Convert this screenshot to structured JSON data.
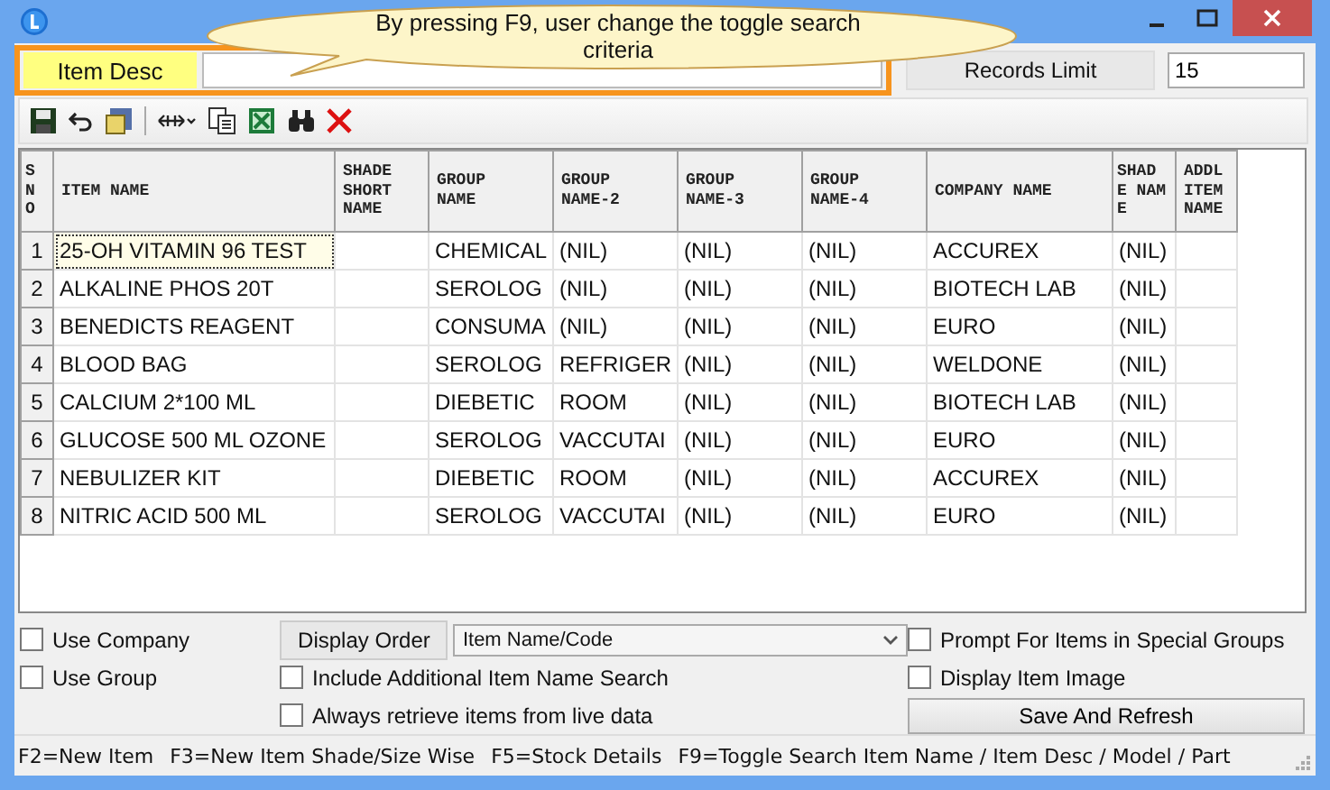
{
  "callout": {
    "text": "By pressing F9, user change the toggle search criteria"
  },
  "search": {
    "mode_label": "Item Desc",
    "records_limit_label": "Records Limit",
    "records_limit": "15"
  },
  "table": {
    "columns": [
      "S N O",
      "ITEM NAME",
      "SHADE SHORT NAME",
      "GROUP NAME",
      "GROUP NAME-2",
      "GROUP NAME-3",
      "GROUP NAME-4",
      "COMPANY NAME",
      "SHAD E NAME",
      "ADDL ITEM NAME"
    ],
    "rows": [
      {
        "selected": true,
        "cells": [
          "1",
          "25-OH VITAMIN 96 TEST",
          "",
          "CHEMICAL",
          "(NIL)",
          "(NIL)",
          "(NIL)",
          "ACCUREX",
          "(NIL)",
          ""
        ]
      },
      {
        "selected": false,
        "cells": [
          "2",
          "ALKALINE PHOS 20T",
          "",
          "SEROLOG",
          "(NIL)",
          "(NIL)",
          "(NIL)",
          "BIOTECH LAB",
          "(NIL)",
          ""
        ]
      },
      {
        "selected": false,
        "cells": [
          "3",
          "BENEDICTS REAGENT",
          "",
          "CONSUMA",
          "(NIL)",
          "(NIL)",
          "(NIL)",
          "EURO",
          "(NIL)",
          ""
        ]
      },
      {
        "selected": false,
        "cells": [
          "4",
          "BLOOD BAG",
          "",
          "SEROLOG",
          "REFRIGER",
          "(NIL)",
          "(NIL)",
          "WELDONE",
          "(NIL)",
          ""
        ]
      },
      {
        "selected": false,
        "cells": [
          "5",
          "CALCIUM 2*100 ML",
          "",
          "DIEBETIC",
          "ROOM",
          "(NIL)",
          "(NIL)",
          "BIOTECH LAB",
          "(NIL)",
          ""
        ]
      },
      {
        "selected": false,
        "cells": [
          "6",
          "GLUCOSE 500 ML OZONE",
          "",
          "SEROLOG",
          "VACCUTAI",
          "(NIL)",
          "(NIL)",
          "EURO",
          "(NIL)",
          ""
        ]
      },
      {
        "selected": false,
        "cells": [
          "7",
          "NEBULIZER KIT",
          "",
          "DIEBETIC",
          "ROOM",
          "(NIL)",
          "(NIL)",
          "ACCUREX",
          "(NIL)",
          ""
        ]
      },
      {
        "selected": false,
        "cells": [
          "8",
          "NITRIC ACID 500 ML",
          "",
          "SEROLOG",
          "VACCUTAI",
          "(NIL)",
          "(NIL)",
          "EURO",
          "(NIL)",
          ""
        ]
      }
    ]
  },
  "options": {
    "use_company": {
      "label": "Use Company",
      "checked": false
    },
    "use_group": {
      "label": "Use Group",
      "checked": false
    },
    "display_order_label": "Display Order",
    "display_order": "Item Name/Code",
    "include_additional": {
      "label": "Include Additional Item Name Search",
      "checked": false
    },
    "always_live": {
      "label": "Always retrieve items from live data",
      "checked": false
    },
    "prompt_special": {
      "label": "Prompt For Items in Special Groups",
      "checked": false
    },
    "display_image": {
      "label": "Display Item Image",
      "checked": false
    },
    "save_button": "Save And Refresh"
  },
  "status_bar": [
    "F2=New Item",
    "F3=New Item Shade/Size Wise",
    "F5=Stock Details",
    "F9=Toggle Search Item Name / Item Desc / Model / Part"
  ]
}
